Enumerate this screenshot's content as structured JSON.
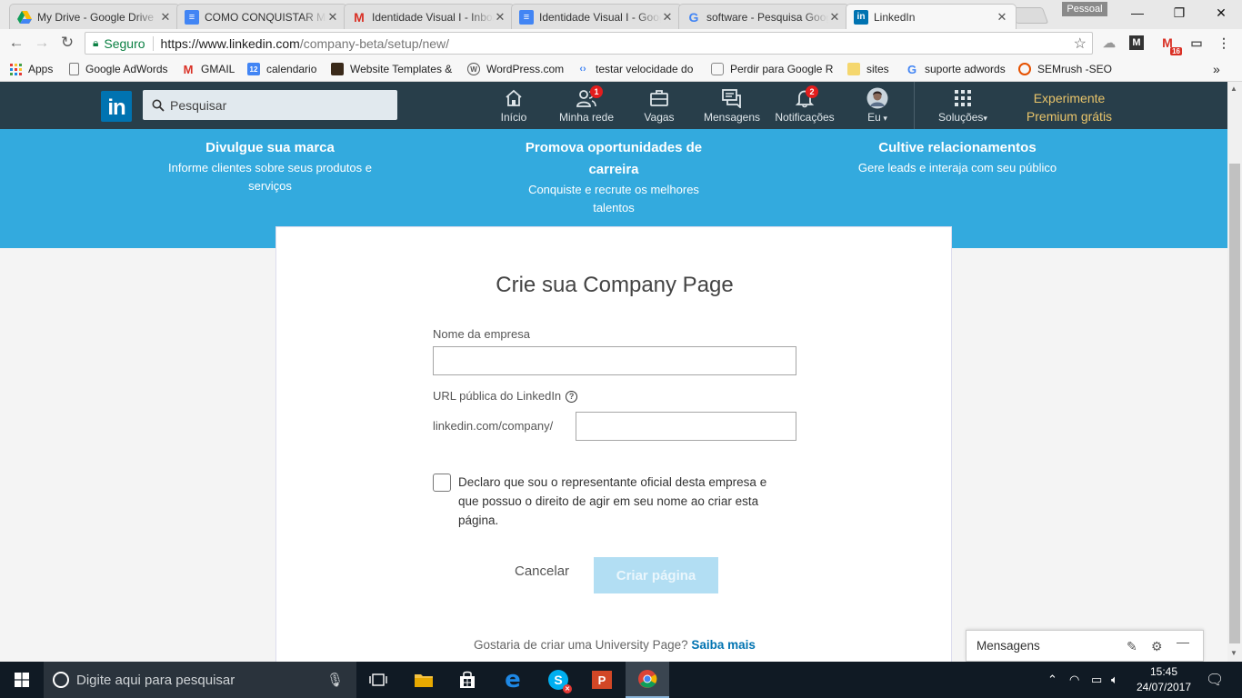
{
  "browser": {
    "tabs": [
      {
        "title": "My Drive - Google Drive",
        "icon": "google-drive-icon"
      },
      {
        "title": "COMO CONQUISTAR MAIS",
        "icon": "google-docs-icon"
      },
      {
        "title": "Identidade Visual I - Inbox",
        "icon": "gmail-icon"
      },
      {
        "title": "Identidade Visual I - Google",
        "icon": "google-docs-icon"
      },
      {
        "title": "software - Pesquisa Google",
        "icon": "google-icon"
      },
      {
        "title": "LinkedIn",
        "icon": "linkedin-icon"
      }
    ],
    "profile_label": "Pessoal",
    "secure_label": "Seguro",
    "url_host": "https://www.linkedin.com",
    "url_path": "/company-beta/setup/new/",
    "gmail_count": "16",
    "bookmarks": [
      {
        "label": "Apps"
      },
      {
        "label": "Google AdWords"
      },
      {
        "label": "GMAIL"
      },
      {
        "label": "calendario"
      },
      {
        "label": "Website Templates &"
      },
      {
        "label": "WordPress.com"
      },
      {
        "label": "testar velocidade do"
      },
      {
        "label": "Perdir para Google R"
      },
      {
        "label": "sites"
      },
      {
        "label": "suporte adwords"
      },
      {
        "label": "SEMrush -SEO"
      }
    ]
  },
  "linkedin": {
    "logo": "in",
    "search_placeholder": "Pesquisar",
    "nav": [
      {
        "label": "Início",
        "icon": "home-icon"
      },
      {
        "label": "Minha rede",
        "icon": "network-icon",
        "badge": "1"
      },
      {
        "label": "Vagas",
        "icon": "jobs-icon"
      },
      {
        "label": "Mensagens",
        "icon": "messages-icon"
      },
      {
        "label": "Notificações",
        "icon": "bell-icon",
        "badge": "2"
      },
      {
        "label": "Eu",
        "icon": "avatar"
      },
      {
        "label": "Soluções",
        "icon": "grid-icon"
      }
    ],
    "premium_line1": "Experimente",
    "premium_line2": "Premium grátis"
  },
  "hero": [
    {
      "title": "Divulgue sua marca",
      "text": "Informe clientes sobre seus produtos e serviços"
    },
    {
      "title": "Promova oportunidades de carreira",
      "text": "Conquiste e recrute os melhores talentos"
    },
    {
      "title": "Cultive relacionamentos",
      "text": "Gere leads e interaja com seu público"
    }
  ],
  "form": {
    "title": "Crie sua Company Page",
    "company_name_label": "Nome da empresa",
    "company_name_value": "",
    "url_label": "URL pública do LinkedIn",
    "url_prefix": "linkedin.com/company/",
    "url_value": "",
    "declaration": "Declaro que sou o representante oficial desta empresa e que possuo o direito de agir em seu nome ao criar esta página.",
    "declaration_checked": false,
    "cancel_label": "Cancelar",
    "create_label": "Criar página",
    "university_text": "Gostaria de criar uma University Page?",
    "university_link": "Saiba mais"
  },
  "messages_widget": {
    "label": "Mensagens"
  },
  "taskbar": {
    "search_placeholder": "Digite aqui para pesquisar",
    "time": "15:45",
    "date": "24/07/2017"
  },
  "colors": {
    "linkedin_nav": "#283e4a",
    "linkedin_blue": "#0073b1",
    "hero_blue": "#33aade",
    "create_disabled": "#b2def3"
  }
}
